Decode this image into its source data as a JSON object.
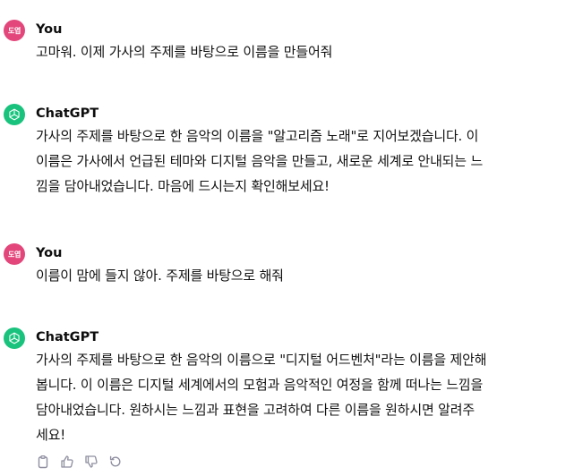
{
  "messages": [
    {
      "role": "user",
      "author": "You",
      "avatar_text": "도엽",
      "lines": [
        "고마워. 이제 가사의 주제를 바탕으로 이름을 만들어줘"
      ]
    },
    {
      "role": "assistant",
      "author": "ChatGPT",
      "lines": [
        "가사의 주제를 바탕으로 한 음악의 이름을 \"알고리즘 노래\"로 지어보겠습니다. 이",
        "이름은 가사에서 언급된 테마와 디지털 음악을 만들고, 새로운 세계로 안내되는 느",
        "낌을 담아내었습니다. 마음에 드시는지 확인해보세요!"
      ]
    },
    {
      "role": "user",
      "author": "You",
      "avatar_text": "도엽",
      "lines": [
        "이름이 맘에 들지 않아. 주제를 바탕으로 해줘"
      ]
    },
    {
      "role": "assistant",
      "author": "ChatGPT",
      "lines": [
        "가사의 주제를 바탕으로 한 음악의 이름으로 \"디지털 어드벤처\"라는 이름을 제안해",
        "봅니다. 이 이름은 디지털 세계에서의 모험과 음악적인 여정을 함께 떠나는 느낌을",
        "담아내었습니다. 원하시는 느낌과 표현을 고려하여 다른 이름을 원하시면 알려주",
        "세요!"
      ]
    }
  ],
  "actions": {
    "copy_icon": "clipboard-icon",
    "like_icon": "thumbs-up-icon",
    "dislike_icon": "thumbs-down-icon",
    "regenerate_icon": "refresh-icon"
  },
  "colors": {
    "user_avatar": "#e3467b",
    "gpt_avatar": "#19c37d",
    "text": "#0d0d0d",
    "icon": "#8e8ea0"
  }
}
